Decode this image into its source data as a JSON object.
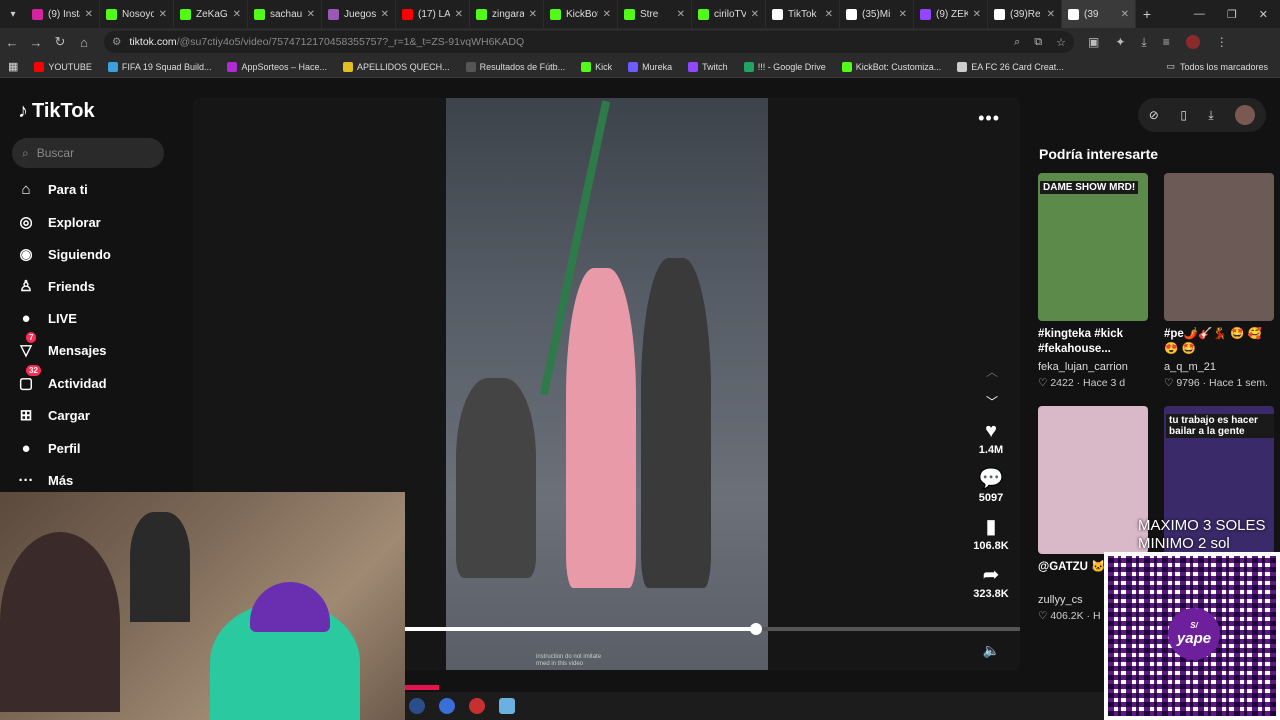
{
  "browser": {
    "tabs": [
      {
        "label": "(9) Insta",
        "color": "#d6249f"
      },
      {
        "label": "Nosoyo",
        "color": "#53fc18"
      },
      {
        "label": "ZeKaGa",
        "color": "#53fc18"
      },
      {
        "label": "sachau",
        "color": "#53fc18"
      },
      {
        "label": "Juegos",
        "color": "#9b59b6"
      },
      {
        "label": "(17) LA",
        "color": "#ff0000"
      },
      {
        "label": "zingara",
        "color": "#53fc18"
      },
      {
        "label": "KickBot",
        "color": "#53fc18"
      },
      {
        "label": "Stre",
        "color": "#53fc18"
      },
      {
        "label": "ciriloTV",
        "color": "#53fc18"
      },
      {
        "label": "TikTok",
        "color": "#ffffff"
      },
      {
        "label": "(35)Mi",
        "color": "#ffffff"
      },
      {
        "label": "(9) ZEK",
        "color": "#9146ff"
      },
      {
        "label": "(39)Re",
        "color": "#ffffff"
      },
      {
        "label": "(39",
        "color": "#ffffff"
      }
    ],
    "url_host": "tiktok.com",
    "url_path": "/@su7ctiy4o5/video/7574712170458355757?_r=1&_t=ZS-91vqWH6KADQ",
    "bookmarks": [
      {
        "label": "YOUTUBE",
        "color": "#ff0000"
      },
      {
        "label": "FIFA 19 Squad Build...",
        "color": "#3aa0e0"
      },
      {
        "label": "AppSorteos – Hace...",
        "color": "#b02ad1"
      },
      {
        "label": "APELLIDOS QUECH...",
        "color": "#e0c020"
      },
      {
        "label": "Resultados de Fútb...",
        "color": "#555555"
      },
      {
        "label": "Kick",
        "color": "#53fc18"
      },
      {
        "label": "Mureka",
        "color": "#6a5cff"
      },
      {
        "label": "Twitch",
        "color": "#9146ff"
      },
      {
        "label": "!!! - Google Drive",
        "color": "#1fa463"
      },
      {
        "label": "KickBot: Customiza...",
        "color": "#53fc18"
      },
      {
        "label": "EA FC 26 Card Creat...",
        "color": "#cccccc"
      }
    ],
    "all_bookmarks": "Todos los marcadores"
  },
  "sidebar": {
    "logo": "TikTok",
    "search_placeholder": "Buscar",
    "items": [
      {
        "label": "Para ti",
        "icon": "home-icon",
        "glyph": "⌂"
      },
      {
        "label": "Explorar",
        "icon": "compass-icon",
        "glyph": "◎"
      },
      {
        "label": "Siguiendo",
        "icon": "following-avatar-icon",
        "glyph": "◉"
      },
      {
        "label": "Friends",
        "icon": "friends-icon",
        "glyph": "♙"
      },
      {
        "label": "LIVE",
        "icon": "live-avatar-icon",
        "glyph": "●"
      },
      {
        "label": "Mensajes",
        "icon": "messages-icon",
        "glyph": "▽",
        "badge": "7"
      },
      {
        "label": "Actividad",
        "icon": "activity-icon",
        "glyph": "▢",
        "badge": "32"
      },
      {
        "label": "Cargar",
        "icon": "upload-icon",
        "glyph": "⊞"
      },
      {
        "label": "Perfil",
        "icon": "profile-avatar-icon",
        "glyph": "●"
      },
      {
        "label": "Más",
        "icon": "more-icon",
        "glyph": "···"
      }
    ]
  },
  "video": {
    "likes": "1.4M",
    "comments": "5097",
    "saves": "106.8K",
    "shares": "323.8K",
    "caption_line1": "instruction do not imitate",
    "caption_line2": "rmed in this video",
    "progress_fraction": 0.57
  },
  "recommendations": {
    "title": "Podría interesarte",
    "cards": [
      {
        "thumb_label": "DAME SHOW MRD!",
        "desc": "#kingteka #kick #fekahouse...",
        "user": "feka_lujan_carrion",
        "likes": "2422",
        "time": "Hace 3 d",
        "bg": "#5c8a4a"
      },
      {
        "thumb_label": "",
        "desc": "#pe🌶️🎸💃 🤩 🥰 😍 🤩 #muchilerosper...",
        "user": "a_q_m_21",
        "likes": "9796",
        "time": "Hace 1 sem.",
        "bg": "#6b5a55"
      },
      {
        "thumb_label": "",
        "desc": "@GATZU 🐱",
        "user": "zullyy_cs",
        "likes": "406.2K",
        "time": "H",
        "bg": "#d9b8c8"
      },
      {
        "thumb_label": "tu trabajo es hacer bailar a la gente",
        "desc": "",
        "user": "",
        "likes": "",
        "time": "",
        "bg": "#3a2a6a"
      }
    ]
  },
  "overlay": {
    "promo_line1": "MAXIMO 3 SOLES",
    "promo_line2": "MINIMO 2 sol",
    "qr_brand": "yape",
    "qr_symbol": "S/"
  }
}
